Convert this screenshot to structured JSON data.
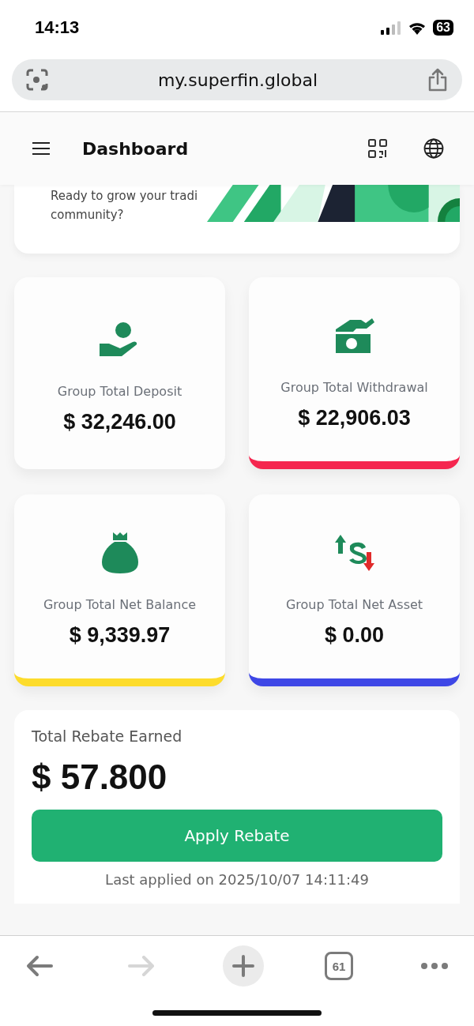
{
  "status_bar": {
    "time": "14:13",
    "battery": "63"
  },
  "address_bar": {
    "url": "my.superfin.global"
  },
  "header": {
    "title": "Dashboard"
  },
  "banner": {
    "lines": [
      "Ready to grow your tradi",
      "community?"
    ],
    "kind": "picture"
  },
  "stats": [
    {
      "kind": "hand-coin",
      "label": "Group Total Deposit",
      "amount": "$ 32,246.00"
    },
    {
      "kind": "cash-deposit",
      "label": "Group Total Withdrawal",
      "amount": "$ 22,906.03",
      "color": "#f5264f"
    },
    {
      "kind": "money-bag",
      "label": "Group Total Net Balance",
      "amount": "$ 9,339.97",
      "color": "#fddc2c"
    },
    {
      "kind": "exchange",
      "label": "Group Total Net Asset",
      "amount": "$ 0.00",
      "color": "#3e47e6"
    }
  ],
  "rebate": {
    "title": "Total Rebate Earned",
    "amount": "$ 57.800",
    "button": "Apply Rebate",
    "note": "Last applied on 2025/10/07 14:11:49"
  },
  "toolbar": [
    {
      "kind": "back",
      "disabled": false
    },
    {
      "kind": "forward",
      "disabled": true
    },
    {
      "kind": "new-tab",
      "disabled": false
    },
    {
      "kind": "tabs",
      "count": "61",
      "disabled": false
    },
    {
      "kind": "more",
      "disabled": false
    }
  ]
}
